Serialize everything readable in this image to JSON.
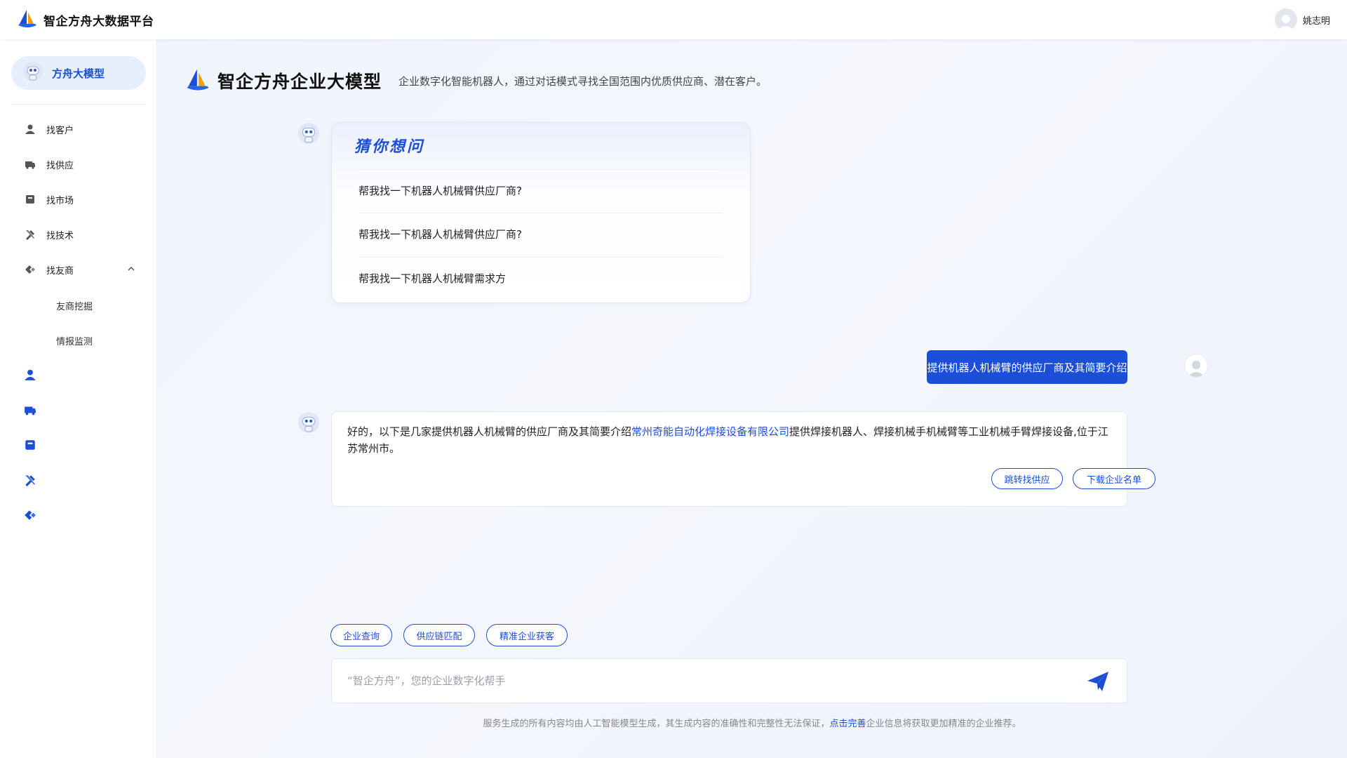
{
  "header": {
    "app_title": "智企方舟大数据平台",
    "user_name": "姚志明"
  },
  "sidebar": {
    "model_label": "方舟大模型",
    "items": [
      {
        "label": "找客户",
        "icon": "user-icon"
      },
      {
        "label": "找供应",
        "icon": "truck-icon"
      },
      {
        "label": "找市场",
        "icon": "book-icon"
      },
      {
        "label": "找技术",
        "icon": "tools-icon"
      },
      {
        "label": "找友商",
        "icon": "handshake-icon",
        "expanded": true
      }
    ],
    "sub_items": [
      "友商挖掘",
      "情报监测"
    ],
    "collapsed_icons": [
      "user-icon",
      "truck-icon",
      "book-icon",
      "tools-icon",
      "handshake-icon"
    ]
  },
  "main": {
    "title": "智企方舟企业大模型",
    "subtitle": "企业数字化智能机器人，通过对话模式寻找全国范围内优质供应商、潜在客户。",
    "suggest": {
      "title": "猜你想问",
      "questions": [
        "帮我找一下机器人机械臂供应厂商?",
        "帮我找一下机器人机械臂供应厂商?",
        "帮我找一下机器人机械臂需求方"
      ]
    },
    "user_message": "提供机器人机械臂的供应厂商及其简要介绍",
    "answer": {
      "prefix": "好的，以下是几家提供机器人机械臂的供应厂商及其简要介绍",
      "company": "常州奇能自动化焊接设备有限公司",
      "suffix": "提供焊接机器人、焊接机械手机械臂等工业机械手臂焊接设备,位于江苏常州市。",
      "btn_jump": "跳转找供应",
      "btn_download": "下载企业名单"
    },
    "quick_chips": [
      "企业查询",
      "供应链匹配",
      "精准企业获客"
    ],
    "input": {
      "value": "",
      "placeholder": "“智企方舟”，您的企业数字化帮手"
    },
    "disclaimer": {
      "before": "服务生成的所有内容均由人工智能模型生成，其生成内容的准确性和完整性无法保证，",
      "link": "点击完善",
      "after": "企业信息将获取更加精准的企业推荐。"
    }
  },
  "colors": {
    "accent": "#1d4ed8",
    "brand_title": "#1a4fd6",
    "background": "#f4f7fd"
  }
}
